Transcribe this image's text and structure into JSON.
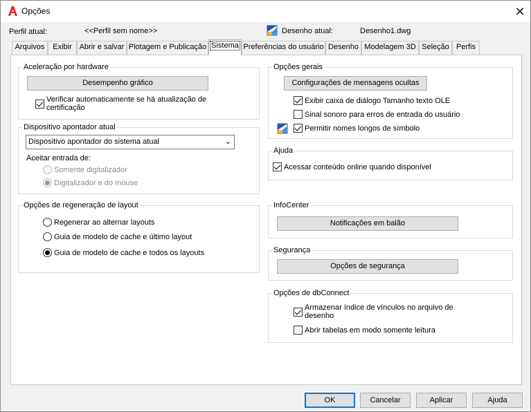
{
  "window": {
    "title": "Opções",
    "close_glyph": "✕",
    "app_icon": "autocad-a-icon"
  },
  "header": {
    "profile_label": "Perfil atual:",
    "profile_value": "<<Perfil sem nome>>",
    "drawing_label": "Desenho atual:",
    "drawing_value": "Desenho1.dwg",
    "drawing_icon": "drawing-file-icon"
  },
  "tabs": [
    {
      "label": "Arquivos"
    },
    {
      "label": "Exibir"
    },
    {
      "label": "Abrir e salvar"
    },
    {
      "label": "Plotagem e Publicação"
    },
    {
      "label": "Sistema"
    },
    {
      "label": "Preferências do usuário"
    },
    {
      "label": "Desenho"
    },
    {
      "label": "Modelagem 3D"
    },
    {
      "label": "Seleção"
    },
    {
      "label": "Perfis"
    }
  ],
  "hardware": {
    "title": "Aceleração por hardware",
    "button": "Desempenho gráfico",
    "check_label": "Verificar automaticamente se há atualização de certificação",
    "check_checked": true
  },
  "pointer": {
    "title": "Dispositivo apontador atual",
    "select_value": "Dispositivo apontador do sistema atual",
    "accept_label": "Aceitar entrada de:",
    "radio_1": "Somente digitalizador",
    "radio_2": "Digitalizador e do mouse"
  },
  "regen": {
    "title": "Opções de regeneração de layout",
    "radio_1": "Regenerar ao alternar layouts",
    "radio_2": "Guia de modelo de cache e último layout",
    "radio_3": "Guia de modelo de cache e todos os layouts"
  },
  "general": {
    "title": "Opções gerais",
    "button": "Configurações de mensagens ocultas",
    "check_1": "Exibir caixa de diálogo Tamanho texto OLE",
    "check_2": "Sinal sonoro para erros de entrada do usuário",
    "check_3": "Permitir nomes longos de símbolo"
  },
  "help": {
    "title": "Ajuda",
    "check_1": "Acessar conteúdo online quando disponível"
  },
  "infocenter": {
    "title": "InfoCenter",
    "button": "Notificações em balão"
  },
  "security": {
    "title": "Segurança",
    "button": "Opções de segurança"
  },
  "dbconnect": {
    "title": "Opções de dbConnect",
    "check_1": "Armazenar índice de vínculos no arquivo de desenho",
    "check_2": "Abrir tabelas em modo somente leitura"
  },
  "footer": {
    "ok": "OK",
    "cancel": "Cancelar",
    "apply": "Aplicar",
    "help": "Ajuda"
  }
}
